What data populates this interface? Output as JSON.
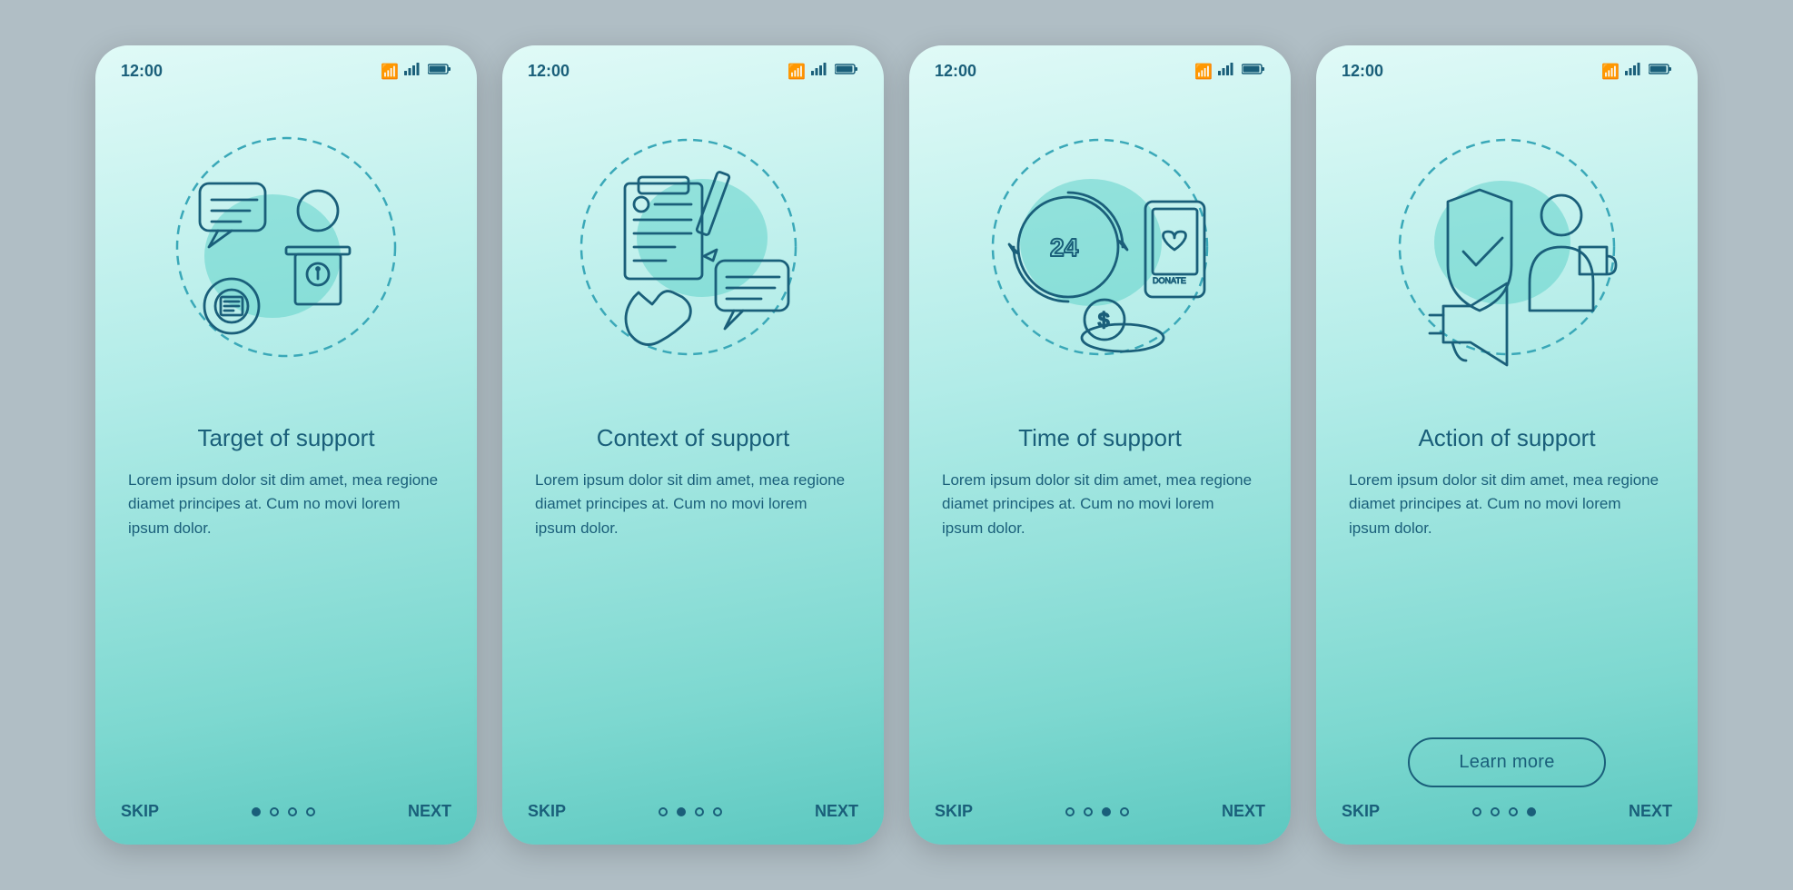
{
  "background": "#b0bec5",
  "screens": [
    {
      "id": "screen-1",
      "time": "12:00",
      "title": "Target of support",
      "description": "Lorem ipsum dolor sit dim amet, mea regione diamet principes at. Cum no movi lorem ipsum dolor.",
      "dots": [
        true,
        false,
        false,
        false
      ],
      "hasButton": false,
      "skipLabel": "SKIP",
      "nextLabel": "NEXT"
    },
    {
      "id": "screen-2",
      "time": "12:00",
      "title": "Context of support",
      "description": "Lorem ipsum dolor sit dim amet, mea regione diamet principes at. Cum no movi lorem ipsum dolor.",
      "dots": [
        false,
        true,
        false,
        false
      ],
      "hasButton": false,
      "skipLabel": "SKIP",
      "nextLabel": "NEXT"
    },
    {
      "id": "screen-3",
      "time": "12:00",
      "title": "Time of support",
      "description": "Lorem ipsum dolor sit dim amet, mea regione diamet principes at. Cum no movi lorem ipsum dolor.",
      "dots": [
        false,
        false,
        true,
        false
      ],
      "hasButton": false,
      "skipLabel": "SKIP",
      "nextLabel": "NEXT"
    },
    {
      "id": "screen-4",
      "time": "12:00",
      "title": "Action of support",
      "description": "Lorem ipsum dolor sit dim amet, mea regione diamet principes at. Cum no movi lorem ipsum dolor.",
      "dots": [
        false,
        false,
        false,
        true
      ],
      "hasButton": true,
      "buttonLabel": "Learn more",
      "skipLabel": "SKIP",
      "nextLabel": "NEXT"
    }
  ]
}
